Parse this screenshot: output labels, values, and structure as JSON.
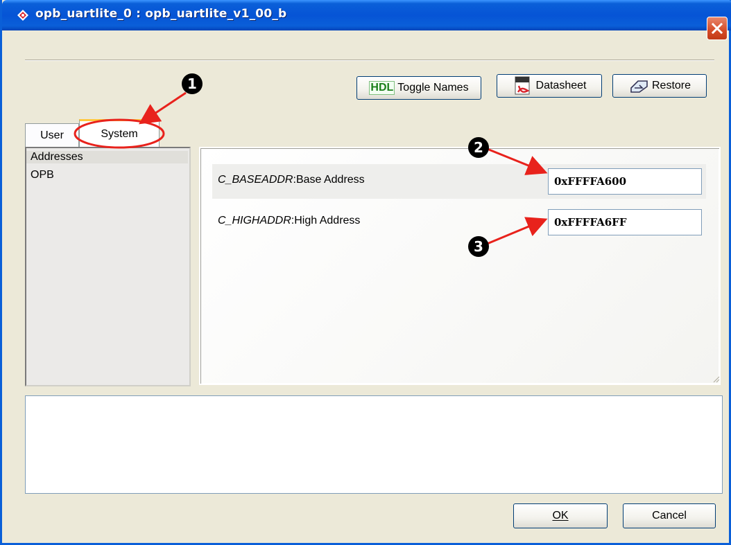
{
  "window": {
    "title": "opb_uartlite_0 : opb_uartlite_v1_00_b"
  },
  "toolbar": {
    "toggle_names_tag": "HDL",
    "toggle_names_label": "Toggle Names",
    "datasheet_label": "Datasheet",
    "restore_label": "Restore"
  },
  "tabs": [
    {
      "label": "User"
    },
    {
      "label": "System",
      "selected": true
    }
  ],
  "categories": [
    {
      "label": "Addresses",
      "selected": true
    },
    {
      "label": "OPB"
    }
  ],
  "params": [
    {
      "name": "C_BASEADDR",
      "desc": "Base Address",
      "value": "0xFFFFA600"
    },
    {
      "name": "C_HIGHADDR",
      "desc": "High Address",
      "value": "0xFFFFA6FF"
    }
  ],
  "buttons": {
    "ok": "OK",
    "cancel": "Cancel"
  },
  "annotations": {
    "markers": [
      "1",
      "2",
      "3"
    ],
    "color": "#e8221c"
  },
  "colors": {
    "titlebar": "#0a5fd8",
    "dialog_bg": "#ece9d8",
    "active_tab_accent": "#ffc83c"
  }
}
